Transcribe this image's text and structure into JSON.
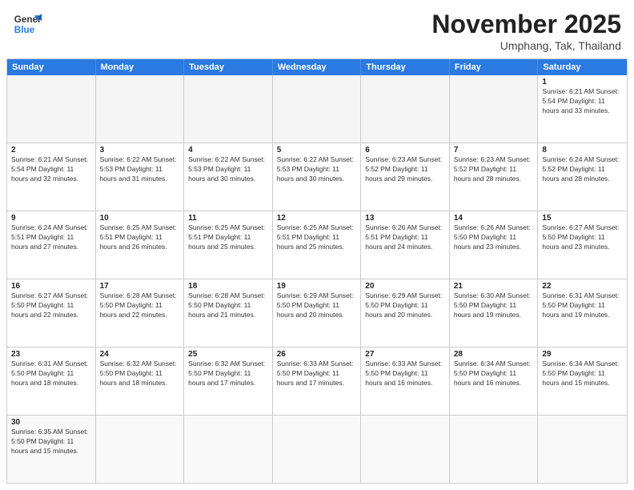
{
  "header": {
    "logo_general": "General",
    "logo_blue": "Blue",
    "month_title": "November 2025",
    "location": "Umphang, Tak, Thailand"
  },
  "days_of_week": [
    "Sunday",
    "Monday",
    "Tuesday",
    "Wednesday",
    "Thursday",
    "Friday",
    "Saturday"
  ],
  "weeks": [
    [
      {
        "day": "",
        "info": ""
      },
      {
        "day": "",
        "info": ""
      },
      {
        "day": "",
        "info": ""
      },
      {
        "day": "",
        "info": ""
      },
      {
        "day": "",
        "info": ""
      },
      {
        "day": "",
        "info": ""
      },
      {
        "day": "1",
        "info": "Sunrise: 6:21 AM\nSunset: 5:54 PM\nDaylight: 11 hours\nand 33 minutes."
      }
    ],
    [
      {
        "day": "2",
        "info": "Sunrise: 6:21 AM\nSunset: 5:54 PM\nDaylight: 11 hours\nand 32 minutes."
      },
      {
        "day": "3",
        "info": "Sunrise: 6:22 AM\nSunset: 5:53 PM\nDaylight: 11 hours\nand 31 minutes."
      },
      {
        "day": "4",
        "info": "Sunrise: 6:22 AM\nSunset: 5:53 PM\nDaylight: 11 hours\nand 30 minutes."
      },
      {
        "day": "5",
        "info": "Sunrise: 6:22 AM\nSunset: 5:53 PM\nDaylight: 11 hours\nand 30 minutes."
      },
      {
        "day": "6",
        "info": "Sunrise: 6:23 AM\nSunset: 5:52 PM\nDaylight: 11 hours\nand 29 minutes."
      },
      {
        "day": "7",
        "info": "Sunrise: 6:23 AM\nSunset: 5:52 PM\nDaylight: 11 hours\nand 28 minutes."
      },
      {
        "day": "8",
        "info": "Sunrise: 6:24 AM\nSunset: 5:52 PM\nDaylight: 11 hours\nand 28 minutes."
      }
    ],
    [
      {
        "day": "9",
        "info": "Sunrise: 6:24 AM\nSunset: 5:51 PM\nDaylight: 11 hours\nand 27 minutes."
      },
      {
        "day": "10",
        "info": "Sunrise: 6:25 AM\nSunset: 5:51 PM\nDaylight: 11 hours\nand 26 minutes."
      },
      {
        "day": "11",
        "info": "Sunrise: 6:25 AM\nSunset: 5:51 PM\nDaylight: 11 hours\nand 25 minutes."
      },
      {
        "day": "12",
        "info": "Sunrise: 6:25 AM\nSunset: 5:51 PM\nDaylight: 11 hours\nand 25 minutes."
      },
      {
        "day": "13",
        "info": "Sunrise: 6:26 AM\nSunset: 5:51 PM\nDaylight: 11 hours\nand 24 minutes."
      },
      {
        "day": "14",
        "info": "Sunrise: 6:26 AM\nSunset: 5:50 PM\nDaylight: 11 hours\nand 23 minutes."
      },
      {
        "day": "15",
        "info": "Sunrise: 6:27 AM\nSunset: 5:50 PM\nDaylight: 11 hours\nand 23 minutes."
      }
    ],
    [
      {
        "day": "16",
        "info": "Sunrise: 6:27 AM\nSunset: 5:50 PM\nDaylight: 11 hours\nand 22 minutes."
      },
      {
        "day": "17",
        "info": "Sunrise: 6:28 AM\nSunset: 5:50 PM\nDaylight: 11 hours\nand 22 minutes."
      },
      {
        "day": "18",
        "info": "Sunrise: 6:28 AM\nSunset: 5:50 PM\nDaylight: 11 hours\nand 21 minutes."
      },
      {
        "day": "19",
        "info": "Sunrise: 6:29 AM\nSunset: 5:50 PM\nDaylight: 11 hours\nand 20 minutes."
      },
      {
        "day": "20",
        "info": "Sunrise: 6:29 AM\nSunset: 5:50 PM\nDaylight: 11 hours\nand 20 minutes."
      },
      {
        "day": "21",
        "info": "Sunrise: 6:30 AM\nSunset: 5:50 PM\nDaylight: 11 hours\nand 19 minutes."
      },
      {
        "day": "22",
        "info": "Sunrise: 6:31 AM\nSunset: 5:50 PM\nDaylight: 11 hours\nand 19 minutes."
      }
    ],
    [
      {
        "day": "23",
        "info": "Sunrise: 6:31 AM\nSunset: 5:50 PM\nDaylight: 11 hours\nand 18 minutes."
      },
      {
        "day": "24",
        "info": "Sunrise: 6:32 AM\nSunset: 5:50 PM\nDaylight: 11 hours\nand 18 minutes."
      },
      {
        "day": "25",
        "info": "Sunrise: 6:32 AM\nSunset: 5:50 PM\nDaylight: 11 hours\nand 17 minutes."
      },
      {
        "day": "26",
        "info": "Sunrise: 6:33 AM\nSunset: 5:50 PM\nDaylight: 11 hours\nand 17 minutes."
      },
      {
        "day": "27",
        "info": "Sunrise: 6:33 AM\nSunset: 5:50 PM\nDaylight: 11 hours\nand 16 minutes."
      },
      {
        "day": "28",
        "info": "Sunrise: 6:34 AM\nSunset: 5:50 PM\nDaylight: 11 hours\nand 16 minutes."
      },
      {
        "day": "29",
        "info": "Sunrise: 6:34 AM\nSunset: 5:50 PM\nDaylight: 11 hours\nand 15 minutes."
      }
    ],
    [
      {
        "day": "30",
        "info": "Sunrise: 6:35 AM\nSunset: 5:50 PM\nDaylight: 11 hours\nand 15 minutes."
      },
      {
        "day": "",
        "info": ""
      },
      {
        "day": "",
        "info": ""
      },
      {
        "day": "",
        "info": ""
      },
      {
        "day": "",
        "info": ""
      },
      {
        "day": "",
        "info": ""
      },
      {
        "day": "",
        "info": ""
      }
    ]
  ]
}
